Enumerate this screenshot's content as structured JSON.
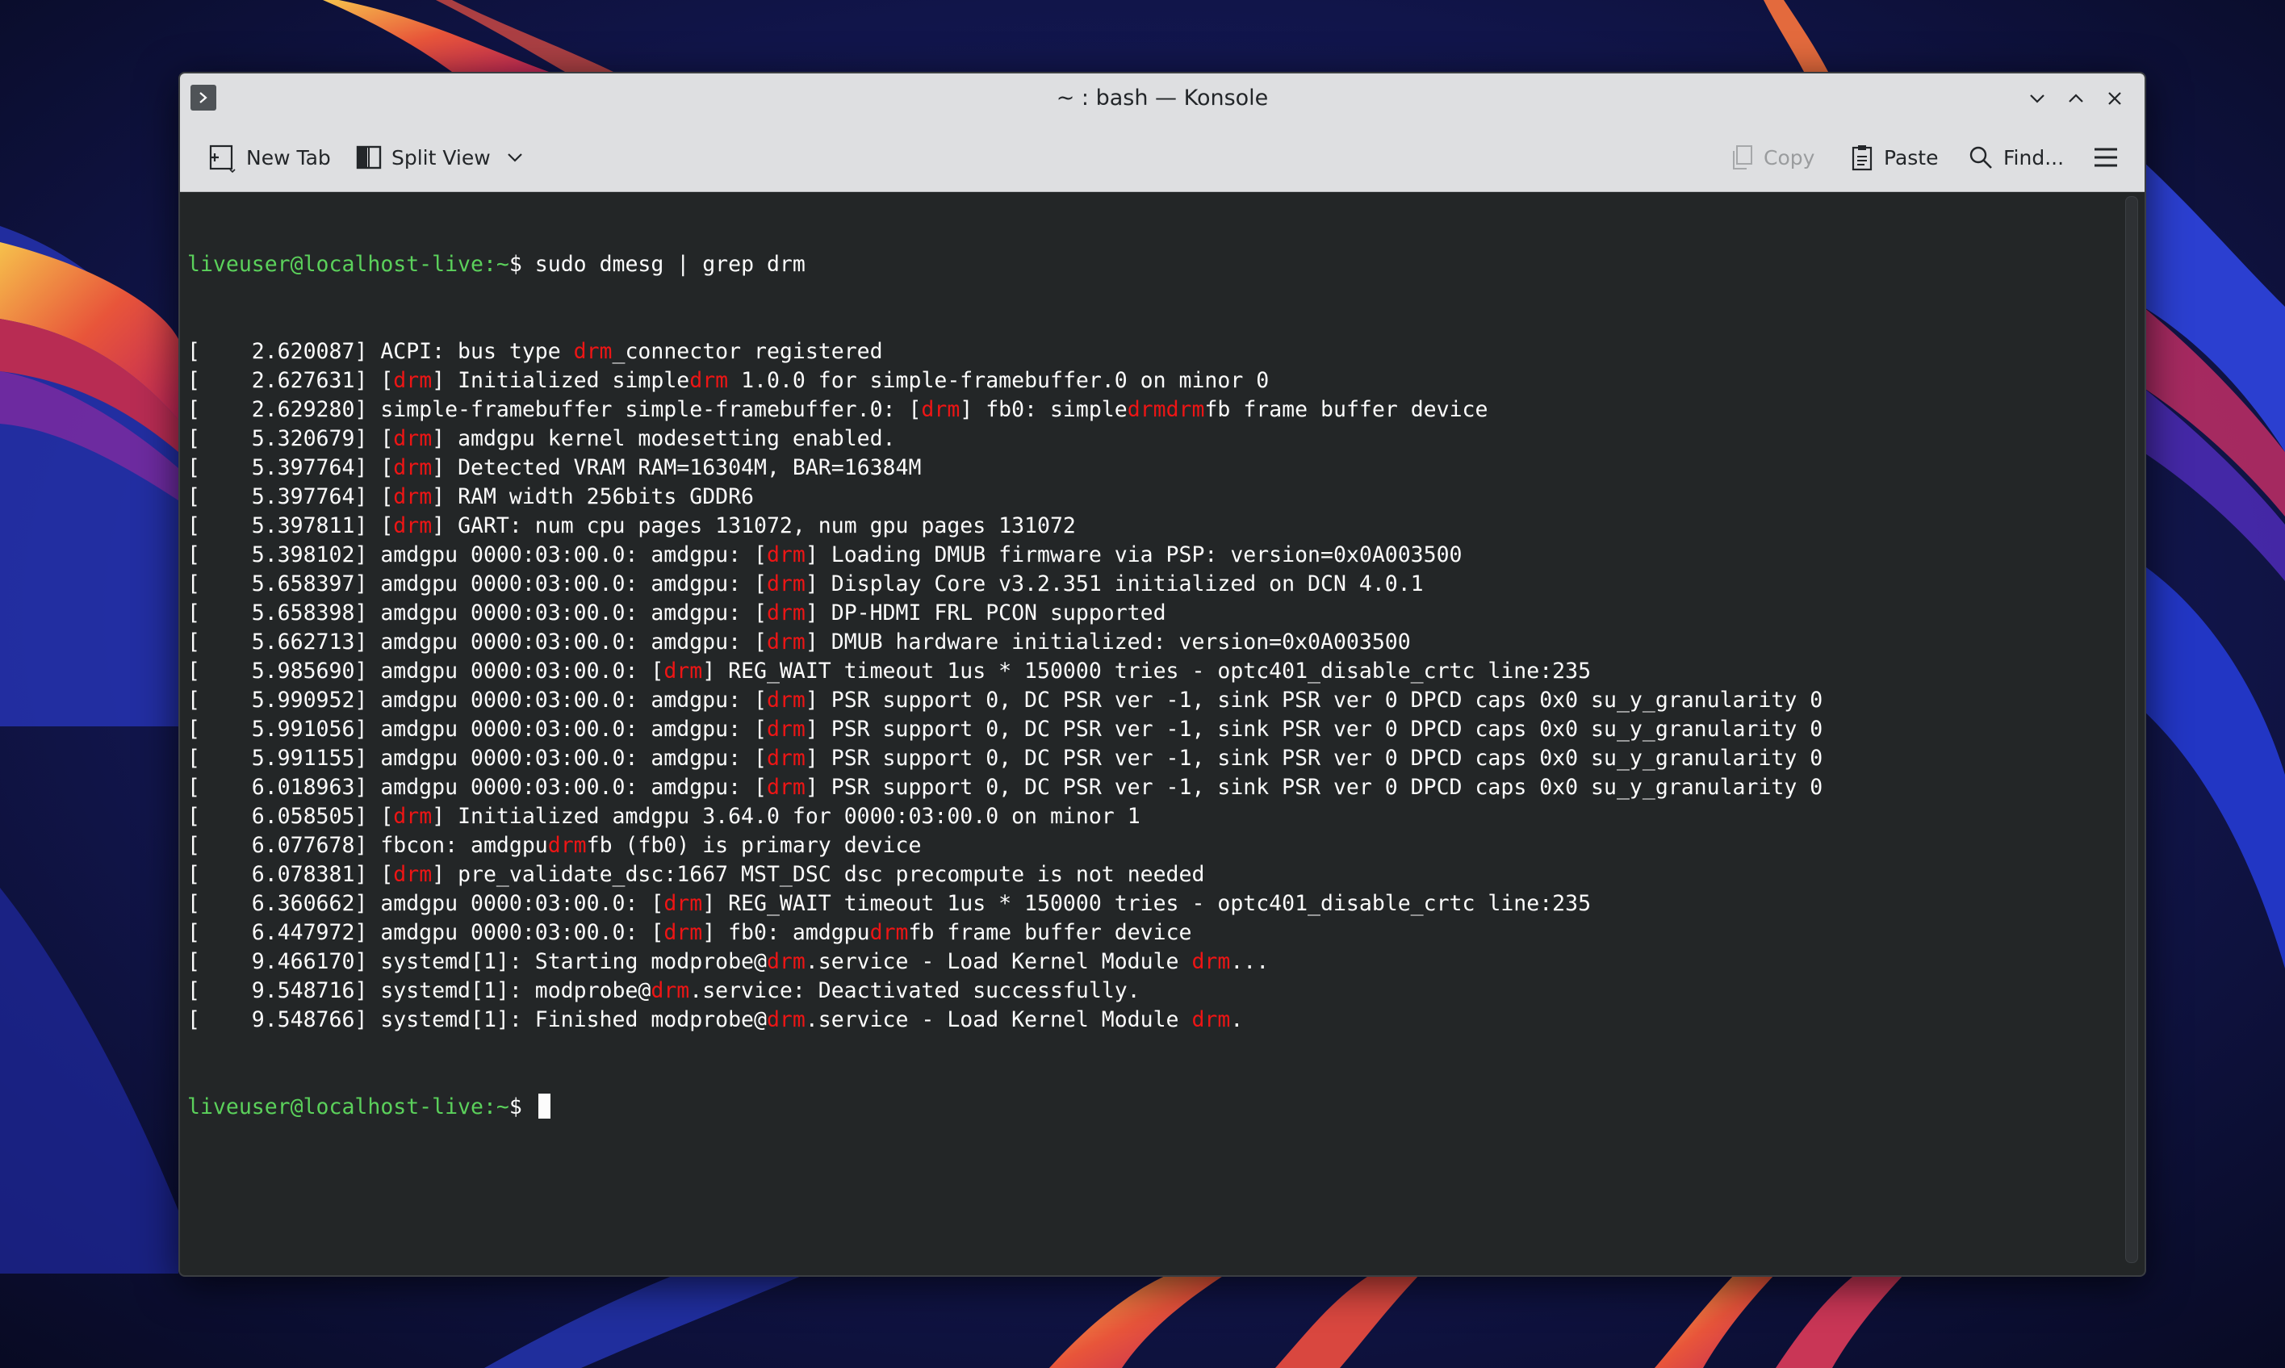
{
  "window": {
    "title": "~ : bash — Konsole"
  },
  "toolbar": {
    "new_tab": "New Tab",
    "split_view": "Split View",
    "copy": "Copy",
    "paste": "Paste",
    "find": "Find..."
  },
  "terminal": {
    "prompt_user_host": "liveuser@localhost-live",
    "prompt_path": ":~",
    "prompt_symbol": "$",
    "command": " sudo dmesg | grep drm",
    "highlight_term": "drm",
    "output_lines": [
      "[    2.620087] ACPI: bus type drm_connector registered",
      "[    2.627631] [drm] Initialized simpledrm 1.0.0 for simple-framebuffer.0 on minor 0",
      "[    2.629280] simple-framebuffer simple-framebuffer.0: [drm] fb0: simpledrmdrmfb frame buffer device",
      "[    5.320679] [drm] amdgpu kernel modesetting enabled.",
      "[    5.397764] [drm] Detected VRAM RAM=16304M, BAR=16384M",
      "[    5.397764] [drm] RAM width 256bits GDDR6",
      "[    5.397811] [drm] GART: num cpu pages 131072, num gpu pages 131072",
      "[    5.398102] amdgpu 0000:03:00.0: amdgpu: [drm] Loading DMUB firmware via PSP: version=0x0A003500",
      "[    5.658397] amdgpu 0000:03:00.0: amdgpu: [drm] Display Core v3.2.351 initialized on DCN 4.0.1",
      "[    5.658398] amdgpu 0000:03:00.0: amdgpu: [drm] DP-HDMI FRL PCON supported",
      "[    5.662713] amdgpu 0000:03:00.0: amdgpu: [drm] DMUB hardware initialized: version=0x0A003500",
      "[    5.985690] amdgpu 0000:03:00.0: [drm] REG_WAIT timeout 1us * 150000 tries - optc401_disable_crtc line:235",
      "[    5.990952] amdgpu 0000:03:00.0: amdgpu: [drm] PSR support 0, DC PSR ver -1, sink PSR ver 0 DPCD caps 0x0 su_y_granularity 0",
      "[    5.991056] amdgpu 0000:03:00.0: amdgpu: [drm] PSR support 0, DC PSR ver -1, sink PSR ver 0 DPCD caps 0x0 su_y_granularity 0",
      "[    5.991155] amdgpu 0000:03:00.0: amdgpu: [drm] PSR support 0, DC PSR ver -1, sink PSR ver 0 DPCD caps 0x0 su_y_granularity 0",
      "[    6.018963] amdgpu 0000:03:00.0: amdgpu: [drm] PSR support 0, DC PSR ver -1, sink PSR ver 0 DPCD caps 0x0 su_y_granularity 0",
      "[    6.058505] [drm] Initialized amdgpu 3.64.0 for 0000:03:00.0 on minor 1",
      "[    6.077678] fbcon: amdgpudrmfb (fb0) is primary device",
      "[    6.078381] [drm] pre_validate_dsc:1667 MST_DSC dsc precompute is not needed",
      "[    6.360662] amdgpu 0000:03:00.0: [drm] REG_WAIT timeout 1us * 150000 tries - optc401_disable_crtc line:235",
      "[    6.447972] amdgpu 0000:03:00.0: [drm] fb0: amdgpudrmfb frame buffer device",
      "[    9.466170] systemd[1]: Starting modprobe@drm.service - Load Kernel Module drm...",
      "[    9.548716] systemd[1]: modprobe@drm.service: Deactivated successfully.",
      "[    9.548766] systemd[1]: Finished modprobe@drm.service - Load Kernel Module drm."
    ]
  },
  "colors": {
    "prompt": "#5bd15b",
    "highlight": "#ed1515",
    "terminal_bg": "#232627",
    "terminal_fg": "#fcfcfc"
  },
  "icons": {
    "app": "konsole-app-icon",
    "minimize": "chevron-down-icon",
    "maximize": "chevron-up-icon",
    "close": "close-icon",
    "new_tab": "new-tab-icon",
    "split_view": "split-view-icon",
    "copy": "copy-icon",
    "paste": "paste-icon",
    "find": "search-icon",
    "menu": "hamburger-menu-icon"
  }
}
